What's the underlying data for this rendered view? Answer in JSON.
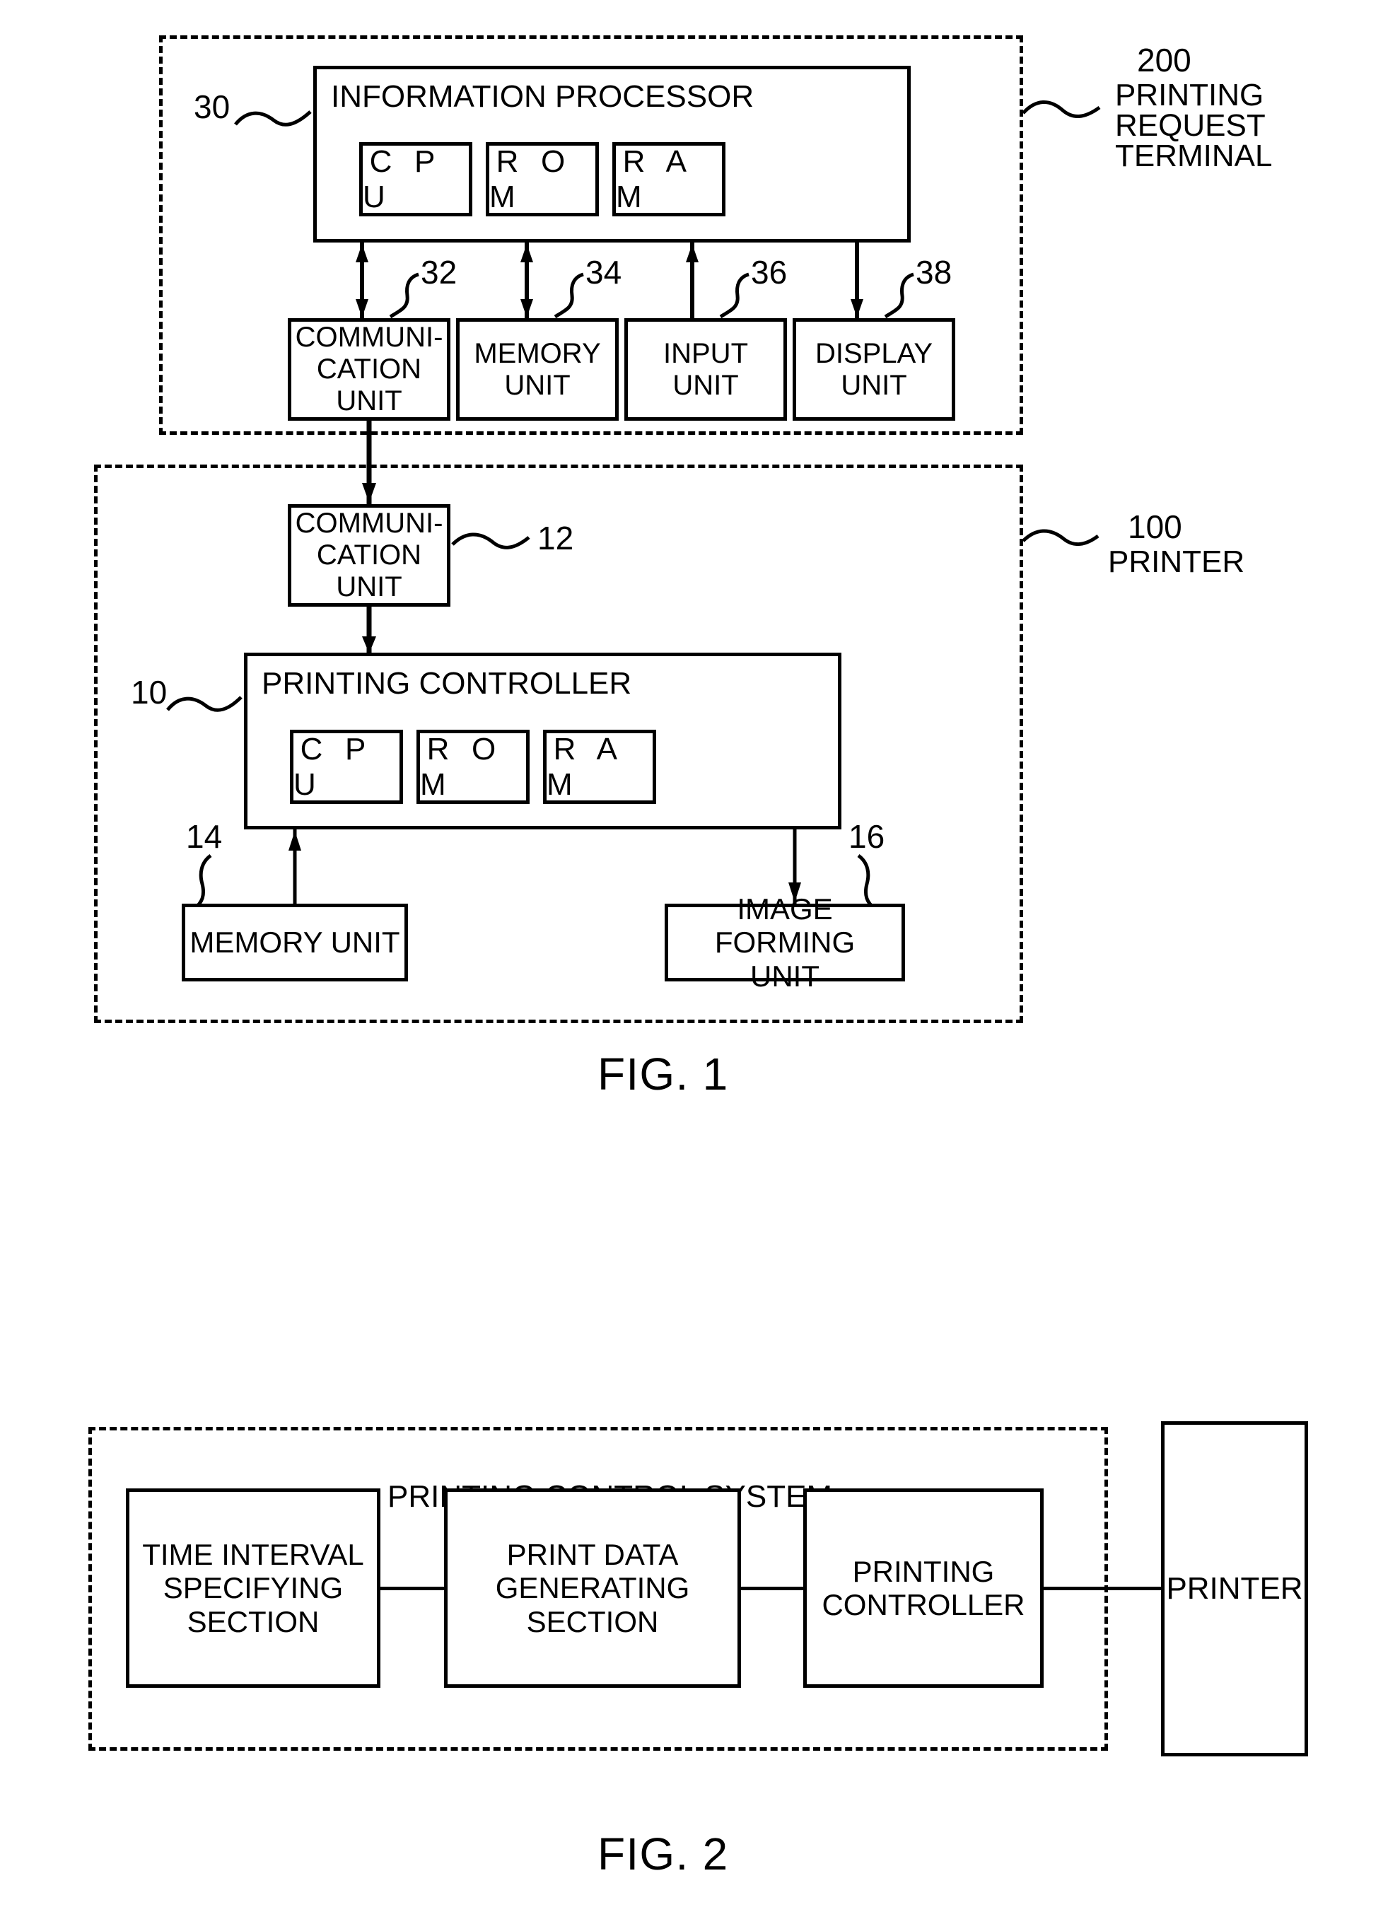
{
  "figures": [
    {
      "caption": "FIG. 1",
      "terminal": {
        "ref": "200",
        "name_line1": "PRINTING",
        "name_line2": "REQUEST",
        "name_line3": "TERMINAL",
        "processor": {
          "ref": "30",
          "title": "INFORMATION PROCESSOR",
          "chips": [
            "C P U",
            "R O M",
            "R A M"
          ]
        },
        "peripherals": [
          {
            "ref": "32",
            "label": "COMMUNI-\nCATION\nUNIT",
            "arrow": "both"
          },
          {
            "ref": "34",
            "label": "MEMORY\nUNIT",
            "arrow": "both"
          },
          {
            "ref": "36",
            "label": "INPUT\nUNIT",
            "arrow": "up"
          },
          {
            "ref": "38",
            "label": "DISPLAY\nUNIT",
            "arrow": "down"
          }
        ]
      },
      "printer": {
        "ref": "100",
        "name": "PRINTER",
        "comm_unit": {
          "ref": "12",
          "label": "COMMUNI-\nCATION\nUNIT"
        },
        "controller": {
          "ref": "10",
          "title": "PRINTING CONTROLLER",
          "chips": [
            "C P U",
            "R O M",
            "R A M"
          ]
        },
        "memory_unit": {
          "ref": "14",
          "label": "MEMORY UNIT"
        },
        "image_forming_unit": {
          "ref": "16",
          "label": "IMAGE FORMING\nUNIT"
        }
      }
    },
    {
      "caption": "FIG. 2",
      "system_title": "PRINTING CONTROL SYSTEM",
      "blocks": [
        {
          "label": "TIME INTERVAL\nSPECIFYING\nSECTION"
        },
        {
          "label": "PRINT DATA\nGENERATING\nSECTION"
        },
        {
          "label": "PRINTING\nCONTROLLER"
        }
      ],
      "external": {
        "label": "PRINTER"
      }
    }
  ],
  "colors": {
    "ink": "#000000",
    "paper": "#ffffff"
  }
}
